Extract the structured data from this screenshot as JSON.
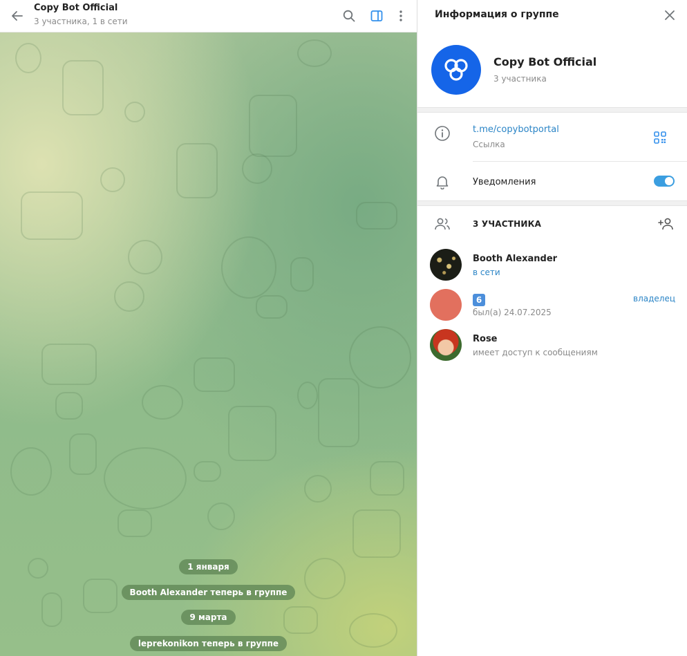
{
  "chat": {
    "title": "Copy Bot Official",
    "subtitle": "3 участника, 1 в сети",
    "service_messages": [
      {
        "text": "1 января"
      },
      {
        "text": "Booth Alexander теперь в группе"
      },
      {
        "text": "9 марта"
      },
      {
        "text": "leprekonikon теперь в группе"
      }
    ]
  },
  "info": {
    "title": "Информация о группе",
    "group_name": "Copy Bot Official",
    "group_count": "3 участника",
    "link": "t.me/copybotportal",
    "link_caption": "Ссылка",
    "notifications_label": "Уведомления",
    "notifications_on": true,
    "members_title": "3 УЧАСТНИКА",
    "members": [
      {
        "name": "Booth Alexander",
        "status": "в сети",
        "role": ""
      },
      {
        "name": "6",
        "status": "был(а) 24.07.2025",
        "role": "владелец"
      },
      {
        "name": "Rose",
        "status": "имеет доступ к сообщениям",
        "role": ""
      }
    ]
  },
  "colors": {
    "accent": "#2a84c6",
    "group_avatar": "#1565e8",
    "toggle_on": "#3b9ee0",
    "member2_avatar": "#e2705e"
  },
  "icons": [
    "back-arrow-icon",
    "search-icon",
    "sidebar-toggle-icon",
    "more-vertical-icon",
    "close-icon",
    "info-icon",
    "qr-code-icon",
    "bell-icon",
    "members-icon",
    "add-member-icon"
  ]
}
